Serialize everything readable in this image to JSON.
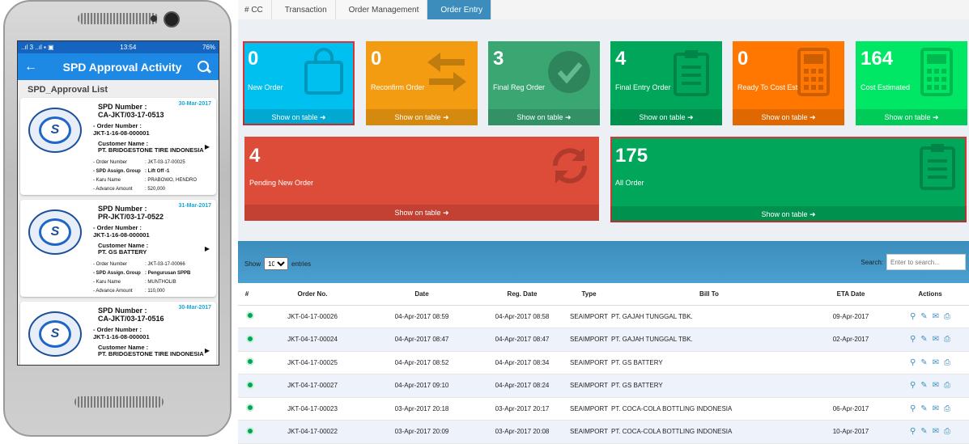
{
  "phone": {
    "status_time": "13:54",
    "status_left": "..ıl 3 ..ıl ▪ ▣",
    "status_right": "76%",
    "app_title": "SPD Approval Activity",
    "list_title": "SPD_Approval List",
    "cards": [
      {
        "spd_label": "SPD Number      :",
        "spd_number": "CA-JKT/03-17-0513",
        "date": "30-Mar-2017",
        "order_label": "- Order Number         :",
        "order_value": "JKT-1-16-08-000001",
        "customer_label": "Customer Name   :",
        "customer_value": "PT. BRIDGESTONE TIRE INDONESIA",
        "rows": [
          {
            "k": "- Order Number",
            "v": ": JKT-03-17-00025",
            "bold": false
          },
          {
            "k": "- SPD Assign. Group",
            "v": ": Lift Off -1",
            "bold": true
          },
          {
            "k": "- Karu Name",
            "v": ": PRABOWO, HENDRO",
            "bold": false
          },
          {
            "k": "- Advance Amount",
            "v": ": 520,000",
            "bold": false
          }
        ]
      },
      {
        "spd_label": "SPD Number      :",
        "spd_number": "PR-JKT/03-17-0522",
        "date": "31-Mar-2017",
        "order_label": "- Order Number         :",
        "order_value": "JKT-1-16-08-000001",
        "customer_label": "Customer Name   :",
        "customer_value": "PT. GS BATTERY",
        "rows": [
          {
            "k": "- Order Number",
            "v": ": JKT-03-17-00066",
            "bold": false
          },
          {
            "k": "- SPD Assign. Group",
            "v": ": Pengurusan SPPB",
            "bold": true
          },
          {
            "k": "- Karu Name",
            "v": ": MUNTHOLIB",
            "bold": false
          },
          {
            "k": "- Advance Amount",
            "v": ": 110,000",
            "bold": false
          }
        ]
      },
      {
        "spd_label": "SPD Number      :",
        "spd_number": "CA-JKT/03-17-0516",
        "date": "30-Mar-2017",
        "order_label": "- Order Number         :",
        "order_value": "JKT-1-16-08-000001",
        "customer_label": "Customer Name   :",
        "customer_value": "PT. BRIDGESTONE TIRE INDONESIA",
        "rows": []
      }
    ]
  },
  "web": {
    "breadcrumb": [
      "# CC",
      "Transaction",
      "Order Management",
      "Order Entry"
    ],
    "show_on_table": "Show on table",
    "boxes": [
      {
        "value": "0",
        "label": "New Order",
        "color": "#00c0ef"
      },
      {
        "value": "0",
        "label": "Reconfirm Order",
        "color": "#f39c12"
      },
      {
        "value": "3",
        "label": "Final Reg Order",
        "color": "#3aa773"
      },
      {
        "value": "4",
        "label": "Final Entry Order",
        "color": "#00a65a"
      },
      {
        "value": "0",
        "label": "Ready To Cost Est",
        "color": "#ff7701"
      },
      {
        "value": "164",
        "label": "Cost Estimated",
        "color": "#00e765"
      },
      {
        "value": "4",
        "label": "Pending New Order",
        "color": "#dd4b39"
      },
      {
        "value": "175",
        "label": "All Order",
        "color": "#00a65a"
      }
    ],
    "table": {
      "show_label": "Show",
      "entries_value": "10",
      "entries_label": "entries",
      "search_label": "Search:",
      "search_placeholder": "Enter to search...",
      "columns": [
        "#",
        "Order No.",
        "Date",
        "Reg. Date",
        "Type",
        "Bill To",
        "ETA Date",
        "Actions"
      ],
      "rows": [
        {
          "order_no": "JKT-04-17-00026",
          "date": "04-Apr-2017 08:59",
          "reg_date": "04-Apr-2017 08:58",
          "type": "SEAIMPORT",
          "bill_to": "PT. GAJAH TUNGGAL TBK.",
          "eta": "09-Apr-2017"
        },
        {
          "order_no": "JKT-04-17-00024",
          "date": "04-Apr-2017 08:47",
          "reg_date": "04-Apr-2017 08:47",
          "type": "SEAIMPORT",
          "bill_to": "PT. GAJAH TUNGGAL TBK.",
          "eta": "02-Apr-2017"
        },
        {
          "order_no": "JKT-04-17-00025",
          "date": "04-Apr-2017 08:52",
          "reg_date": "04-Apr-2017 08:34",
          "type": "SEAIMPORT",
          "bill_to": "PT. GS BATTERY",
          "eta": ""
        },
        {
          "order_no": "JKT-04-17-00027",
          "date": "04-Apr-2017 09:10",
          "reg_date": "04-Apr-2017 08:24",
          "type": "SEAIMPORT",
          "bill_to": "PT. GS BATTERY",
          "eta": ""
        },
        {
          "order_no": "JKT-04-17-00023",
          "date": "03-Apr-2017 20:18",
          "reg_date": "03-Apr-2017 20:17",
          "type": "SEAIMPORT",
          "bill_to": "PT. COCA-COLA BOTTLING INDONESIA",
          "eta": "06-Apr-2017"
        },
        {
          "order_no": "JKT-04-17-00022",
          "date": "03-Apr-2017 20:09",
          "reg_date": "03-Apr-2017 20:08",
          "type": "SEAIMPORT",
          "bill_to": "PT. COCA-COLA BOTTLING INDONESIA",
          "eta": "10-Apr-2017"
        }
      ]
    }
  }
}
